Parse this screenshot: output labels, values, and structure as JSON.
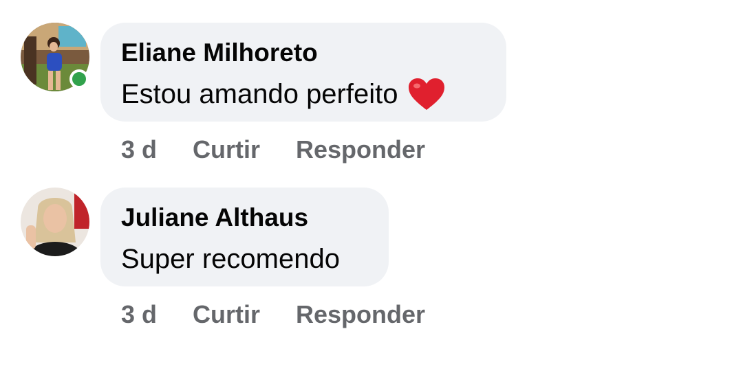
{
  "comments": [
    {
      "author": "Eliane Milhoreto",
      "text": "Estou amando perfeito",
      "emoji_icon": "red-heart-icon",
      "online": true,
      "time": "3 d",
      "like_label": "Curtir",
      "reply_label": "Responder"
    },
    {
      "author": "Juliane Althaus",
      "text": "Super recomendo",
      "online": false,
      "time": "3 d",
      "like_label": "Curtir",
      "reply_label": "Responder"
    }
  ],
  "colors": {
    "bubble_bg": "#f0f2f5",
    "author_text": "#050505",
    "meta_text": "#65676b",
    "online_green": "#31a24c",
    "heart_red": "#e0202e"
  }
}
